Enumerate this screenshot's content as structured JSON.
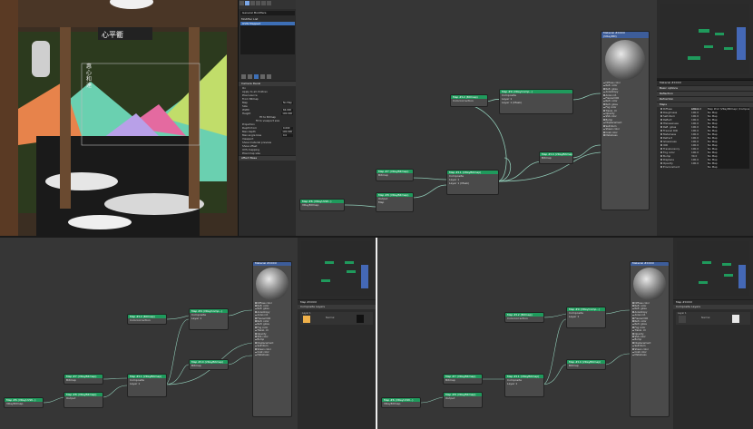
{
  "colors": {
    "node_header": "#1f9a5c",
    "material_header": "#3d5d9a",
    "graph_bg": "#363636",
    "panel_bg": "#2b2b2b",
    "wire": "#8fc9b5"
  },
  "viewport": {
    "sign_text": "心平衢",
    "vertical_text": "惠心和達"
  },
  "material_panel": {
    "dropdown": "General Modifiers",
    "list_header": "Modifier List",
    "list_item": "UVW Mapped",
    "section_camera_decal": "Camera Decal",
    "opt_on": "On",
    "opt_apply_to_all": "Apply to all children",
    "rollout_pixel_source": "Pixel source",
    "opt_bitmap": "From Bitmap",
    "opt_map": "Map",
    "map_btn": "No Map",
    "size_label": "Size",
    "width_label": "Width",
    "width_val": "66.000",
    "height_label": "Height",
    "height_val": "100.000",
    "fit_bitmap": "Fit to Bitmap",
    "fit_viewport": "Fit to viewport size",
    "projection_label": "Projection",
    "depth_from": "Depth from",
    "depth_from_val": "0.000",
    "max_depth": "Max depth",
    "max_depth_val": "100.000",
    "max_angle": "Max angle bias",
    "max_angle_val": "0.0",
    "viewport_label": "Viewport",
    "show_map": "Show material preview",
    "show_offset": "Show offset",
    "uv_label": "UVS mapping",
    "pixel_map_size": "Pixel map size",
    "section_affect": "Affect Base"
  },
  "graph": {
    "nodes": [
      {
        "title": "Map #6 (VRayUVW...)",
        "sub": "VRayBitmap"
      },
      {
        "title": "Map #7 (VRayBitmap)",
        "sub": "Bitmap"
      },
      {
        "title": "Map #8 (VRayBitmap)",
        "sub": "Output"
      },
      {
        "title": "Map #9 (VRayComp...)",
        "sub": "Composite"
      },
      {
        "title": "Map #10 (VRayBitmap)",
        "sub": "Bitmap"
      },
      {
        "title": "Map #11 (VRayBitmap)",
        "sub": "Composite"
      },
      {
        "title": "Map #12 (Bitmap)",
        "sub": "Colorcorrection"
      },
      {
        "title": "Map #13 (VRayBitmap)",
        "sub": "Bitmap"
      }
    ],
    "rows": {
      "map": "Map",
      "layer1": "Layer 1",
      "layer1mask": "Layer 1 (Mask)",
      "output": "Output"
    },
    "material": {
      "title": "Material #XXXX",
      "sub": "(VRayMtl)",
      "slots": [
        "Diffuse color",
        "Refl. color",
        "Refl. gloss",
        "Anisotropy",
        "Aniso rot.",
        "Fresnel IOR",
        "Refr. color",
        "Refr. gloss",
        "Fog color",
        "Transl. clr",
        "Opacity",
        "SSS color",
        "Bump",
        "Displacement",
        "Self-illum",
        "Sheen color",
        "Coat color",
        "Metalness"
      ]
    }
  },
  "right_panel": {
    "header": "Material #XXXX",
    "sections": [
      "Basic options",
      "Reflection",
      "Refraction",
      "Maps"
    ],
    "maps": [
      {
        "name": "Diffuse",
        "amount": "100.0",
        "map": "Map #12 (VRayBitmap) (Composite)"
      },
      {
        "name": "Roughness",
        "amount": "100.0",
        "map": "No Map"
      },
      {
        "name": "Self-illum",
        "amount": "100.0",
        "map": "No Map"
      },
      {
        "name": "Reflect",
        "amount": "100.0",
        "map": "No Map"
      },
      {
        "name": "HGlossiness",
        "amount": "100.0",
        "map": "No Map"
      },
      {
        "name": "Refl. gloss",
        "amount": "100.0",
        "map": "No Map"
      },
      {
        "name": "Fresnel IOR",
        "amount": "100.0",
        "map": "No Map"
      },
      {
        "name": "Metalness",
        "amount": "100.0",
        "map": "No Map"
      },
      {
        "name": "Refract",
        "amount": "100.0",
        "map": "No Map"
      },
      {
        "name": "Glossiness",
        "amount": "100.0",
        "map": "No Map"
      },
      {
        "name": "IOR",
        "amount": "100.0",
        "map": "No Map"
      },
      {
        "name": "Translucency",
        "amount": "100.0",
        "map": "No Map"
      },
      {
        "name": "Fog color",
        "amount": "100.0",
        "map": "No Map"
      },
      {
        "name": "Bump",
        "amount": "30.0",
        "map": "No Map"
      },
      {
        "name": "Displace",
        "amount": "100.0",
        "map": "No Map"
      },
      {
        "name": "Opacity",
        "amount": "100.0",
        "map": "No Map"
      },
      {
        "name": "Environment",
        "amount": "",
        "map": "No Map"
      }
    ],
    "cols": {
      "amount": "Amount",
      "map": "Map"
    }
  },
  "layer_panel": {
    "title": "Map #XXXX",
    "sub": "Composite Layers",
    "layer_label": "Layer 1",
    "blend_label": "Normal",
    "opacity": "100.0",
    "mask": "Mask",
    "blend_mode": "Normal"
  }
}
